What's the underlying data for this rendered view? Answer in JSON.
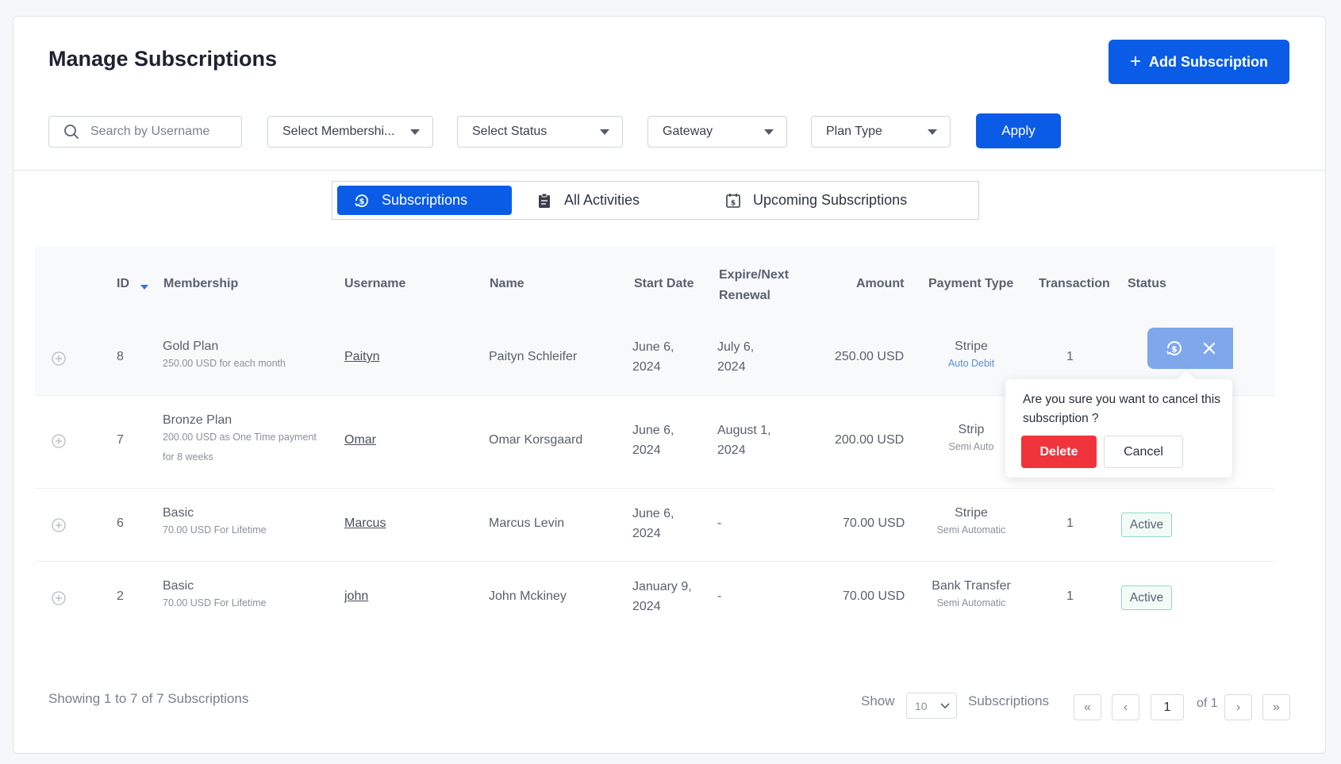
{
  "header": {
    "title": "Manage Subscriptions",
    "add_button": "Add Subscription"
  },
  "filters": {
    "search_placeholder": "Search by Username",
    "membership": "Select Membershi...",
    "status": "Select Status",
    "gateway": "Gateway",
    "plan_type": "Plan Type",
    "apply": "Apply"
  },
  "tabs": [
    {
      "label": "Subscriptions",
      "icon": "dollar-refresh-icon",
      "active": true
    },
    {
      "label": "All Activities",
      "icon": "clipboard-icon",
      "active": false
    },
    {
      "label": "Upcoming Subscriptions",
      "icon": "calendar-dollar-icon",
      "active": false
    }
  ],
  "table": {
    "columns": {
      "id": "ID",
      "membership": "Membership",
      "username": "Username",
      "name": "Name",
      "start_date": "Start Date",
      "expire_1": "Expire/Next",
      "expire_2": "Renewal",
      "amount": "Amount",
      "payment_type": "Payment Type",
      "transaction": "Transaction",
      "status": "Status"
    },
    "rows": [
      {
        "id": "8",
        "plan": "Gold Plan",
        "plan_sub_1": "250.00 USD for each month",
        "plan_sub_2": "",
        "username": "Paityn",
        "name": "Paityn Schleifer",
        "start_1": "June 6,",
        "start_2": "2024",
        "expire_1": "July 6,",
        "expire_2": "2024",
        "amount": "250.00 USD",
        "gateway": "Stripe",
        "pay_mode": "Auto Debit",
        "transaction": "1",
        "status": ""
      },
      {
        "id": "7",
        "plan": "Bronze Plan",
        "plan_sub_1": "200.00 USD as One Time payment",
        "plan_sub_2": "for 8 weeks",
        "username": "Omar",
        "name": "Omar Korsgaard",
        "start_1": "June 6,",
        "start_2": "2024",
        "expire_1": "August 1,",
        "expire_2": "2024",
        "amount": "200.00 USD",
        "gateway": "Strip",
        "pay_mode": "Semi Auto",
        "transaction": "",
        "status": ""
      },
      {
        "id": "6",
        "plan": "Basic",
        "plan_sub_1": "70.00 USD For Lifetime",
        "plan_sub_2": "",
        "username": "Marcus",
        "name": "Marcus Levin",
        "start_1": "June 6,",
        "start_2": "2024",
        "expire_1": "-",
        "expire_2": "",
        "amount": "70.00 USD",
        "gateway": "Stripe",
        "pay_mode": "Semi Automatic",
        "transaction": "1",
        "status": "Active"
      },
      {
        "id": "2",
        "plan": "Basic",
        "plan_sub_1": "70.00 USD For Lifetime",
        "plan_sub_2": "",
        "username": "john",
        "name": "John Mckiney",
        "start_1": "January 9,",
        "start_2": "2024",
        "expire_1": "-",
        "expire_2": "",
        "amount": "70.00 USD",
        "gateway": "Bank Transfer",
        "pay_mode": "Semi Automatic",
        "transaction": "1",
        "status": "Active"
      }
    ]
  },
  "popover": {
    "message": "Are you sure you want to cancel this subscription ?",
    "delete": "Delete",
    "cancel": "Cancel"
  },
  "footer": {
    "showing": "Showing 1 to 7 of 7 Subscriptions",
    "show": "Show",
    "per_page": "10",
    "subscriptions": "Subscriptions",
    "first": "«",
    "prev": "‹",
    "page": "1",
    "of": "of 1",
    "next": "›",
    "last": "»"
  },
  "colors": {
    "primary": "#0a5ce6",
    "danger": "#f0343c",
    "action_pill": "#7ea7ec",
    "active_border": "#8fd9c4"
  }
}
